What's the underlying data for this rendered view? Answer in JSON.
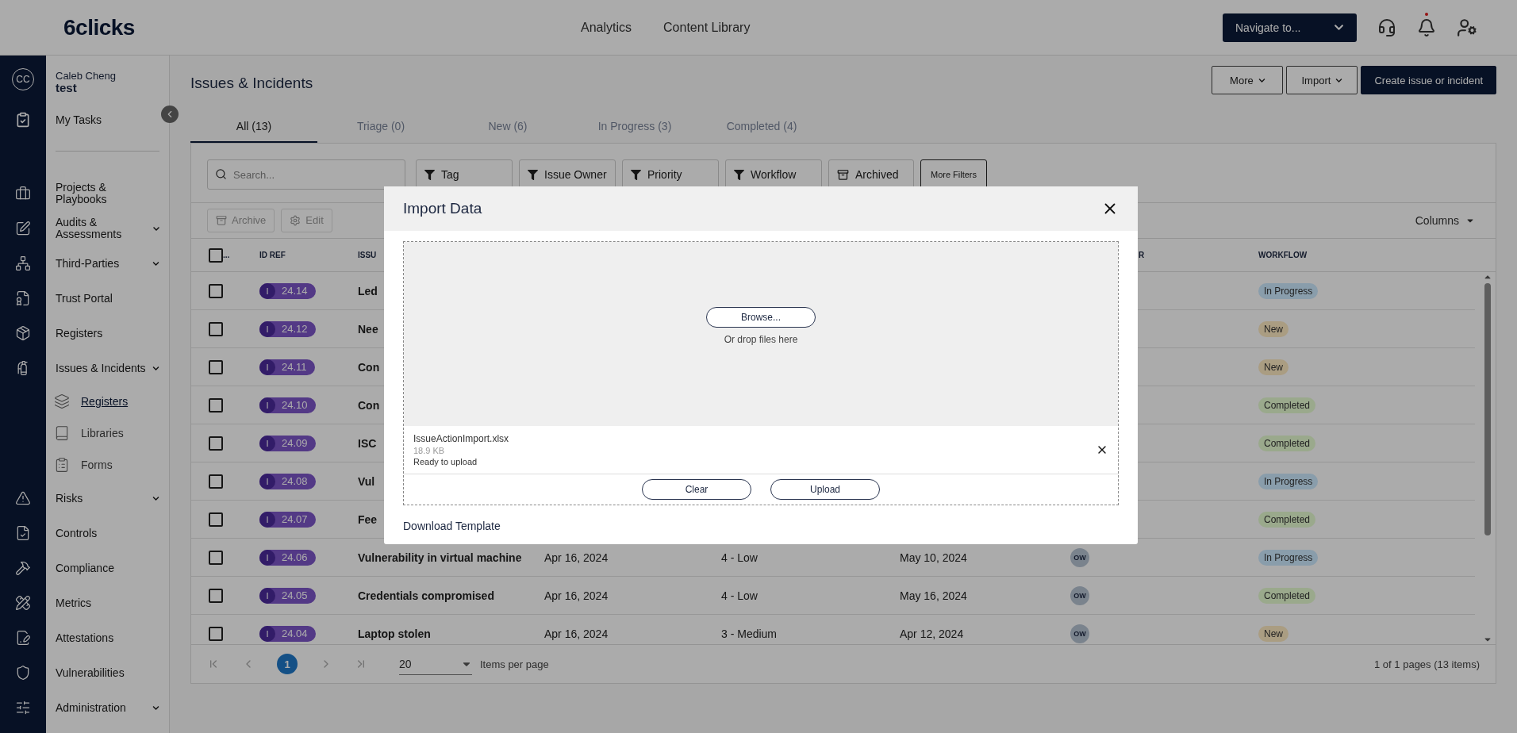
{
  "header": {
    "logo": "6clicks",
    "nav": [
      "Analytics",
      "Content Library"
    ],
    "navigate": "Navigate to...",
    "notification_dot": true
  },
  "sidebar": {
    "avatar": "CC",
    "user_name": "Caleb Cheng",
    "workspace": "test",
    "top_items": [
      {
        "label": "My Tasks"
      }
    ],
    "items": [
      {
        "label": "Projects & Playbooks",
        "has_submenu": false
      },
      {
        "label": "Audits & Assessments",
        "has_submenu": true
      },
      {
        "label": "Third-Parties",
        "has_submenu": true
      },
      {
        "label": "Trust Portal",
        "has_submenu": false
      },
      {
        "label": "Registers",
        "has_submenu": false
      },
      {
        "label": "Issues & Incidents",
        "has_submenu": true,
        "children": [
          {
            "label": "Registers",
            "selected": true
          },
          {
            "label": "Libraries",
            "selected": false
          },
          {
            "label": "Forms",
            "selected": false
          }
        ]
      },
      {
        "label": "Risks",
        "has_submenu": true
      },
      {
        "label": "Controls",
        "has_submenu": false
      },
      {
        "label": "Compliance",
        "has_submenu": false
      },
      {
        "label": "Metrics",
        "has_submenu": false
      },
      {
        "label": "Attestations",
        "has_submenu": false
      },
      {
        "label": "Vulnerabilities",
        "has_submenu": false
      },
      {
        "label": "Administration",
        "has_submenu": true
      }
    ]
  },
  "page": {
    "title": "Issues & Incidents",
    "actions": [
      {
        "label": "More",
        "kind": "dropdown"
      },
      {
        "label": "Import",
        "kind": "dropdown"
      },
      {
        "label": "Create issue or incident",
        "kind": "primary"
      }
    ],
    "tabs": [
      {
        "label": "All (13)",
        "selected": true
      },
      {
        "label": "Triage (0)",
        "selected": false
      },
      {
        "label": "New (6)",
        "selected": false
      },
      {
        "label": "In Progress (3)",
        "selected": false
      },
      {
        "label": "Completed (4)",
        "selected": false
      }
    ]
  },
  "filters": {
    "search_placeholder": "Search...",
    "buttons": [
      {
        "label": "Tag",
        "kind": "filter"
      },
      {
        "label": "Issue Owner",
        "kind": "filter"
      },
      {
        "label": "Priority",
        "kind": "filter"
      },
      {
        "label": "Workflow",
        "kind": "filter"
      },
      {
        "label": "Archived",
        "kind": "archive"
      },
      {
        "label": "More Filters",
        "kind": "plain"
      }
    ]
  },
  "toolbar": {
    "actions": [
      {
        "label": "Archive",
        "kind": "archive",
        "disabled": true
      },
      {
        "label": "Edit",
        "kind": "edit",
        "disabled": true
      }
    ],
    "columns_menu": "Columns"
  },
  "table": {
    "header": {
      "select_all_checked": false,
      "select": "...",
      "id": "ID REF",
      "title": "ISSU",
      "owner": "R",
      "workflow": "WORKFLOW"
    },
    "rows": [
      {
        "checked": false,
        "type": "I",
        "id": "24.14",
        "title": "Led",
        "workflow": "In Progress",
        "color": "#899dab"
      },
      {
        "checked": false,
        "type": "I",
        "id": "24.12",
        "title": "Nee",
        "workflow": "New",
        "color": "#aa9d82"
      },
      {
        "checked": false,
        "type": "I",
        "id": "24.11",
        "title": "Con",
        "workflow": "New",
        "color": "#aa9d82"
      },
      {
        "checked": false,
        "type": "I",
        "id": "24.10",
        "title": "Con",
        "workflow": "Completed",
        "color": "#9aa98c"
      },
      {
        "checked": false,
        "type": "I",
        "id": "24.09",
        "title": "ISC",
        "workflow": "Completed",
        "color": "#9aa98c"
      },
      {
        "checked": false,
        "type": "I",
        "id": "24.08",
        "title": "Vul",
        "workflow": "In Progress",
        "color": "#899dab"
      },
      {
        "checked": false,
        "type": "I",
        "id": "24.07",
        "title": "Fee",
        "workflow": "Completed",
        "color": "#9aa98c"
      },
      {
        "checked": false,
        "type": "I",
        "id": "24.06",
        "title": "Vulnerability in virtual machine",
        "created": "Apr 16, 2024",
        "priority": "4 - Low",
        "due": "May 10, 2024",
        "owner": "OW",
        "workflow": "In Progress",
        "color": "#899dab"
      },
      {
        "checked": false,
        "type": "I",
        "id": "24.05",
        "title": "Credentials compromised",
        "created": "Apr 16, 2024",
        "priority": "4 - Low",
        "due": "May 16, 2024",
        "owner": "OW",
        "workflow": "Completed",
        "color": "#9aa98c"
      },
      {
        "checked": false,
        "type": "I",
        "id": "24.04",
        "title": "Laptop stolen",
        "created": "Apr 16, 2024",
        "priority": "3 - Medium",
        "due": "Apr 12, 2024",
        "owner": "OW",
        "workflow": "New",
        "color": "#aa9d82"
      }
    ]
  },
  "pagination": {
    "pages": [
      {
        "label": "1",
        "selected": true
      }
    ],
    "per_page": "20",
    "per_page_label": "Items per page",
    "summary": "1 of 1 pages (13 items)"
  },
  "modal": {
    "title": "Import Data",
    "browse": "Browse...",
    "drop_hint": "Or drop files here",
    "file": {
      "name": "IssueActionImport.xlsx",
      "size": "18.9 KB",
      "status": "Ready to upload"
    },
    "actions": [
      "Clear",
      "Upload"
    ],
    "link": "Download Template"
  }
}
